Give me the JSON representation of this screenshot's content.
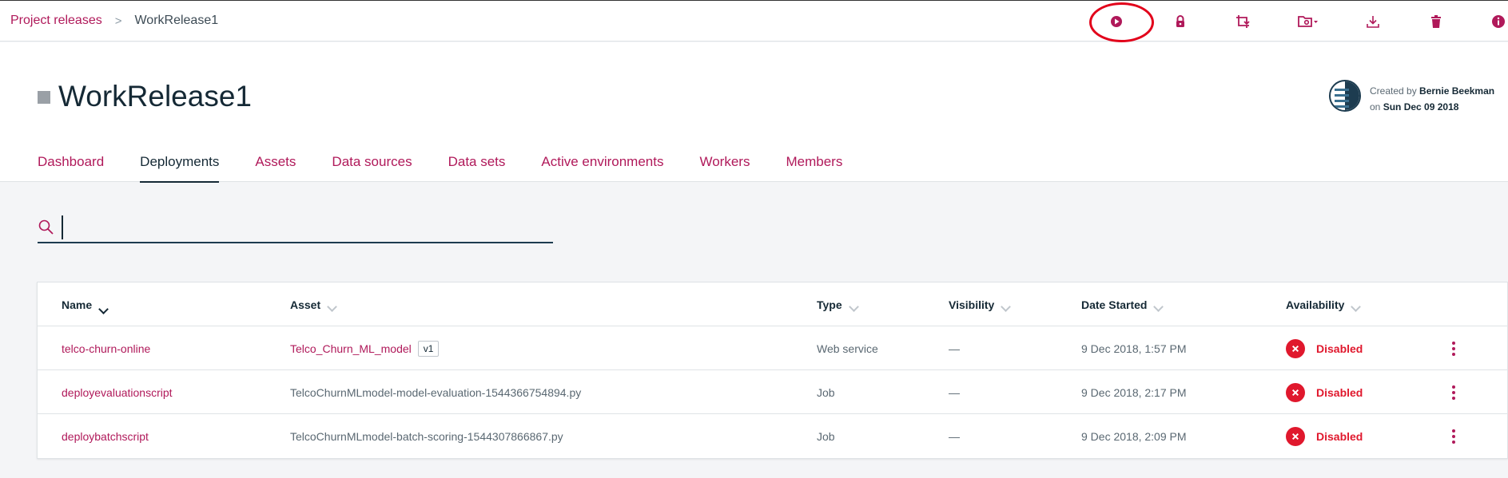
{
  "breadcrumb": {
    "parent": "Project releases",
    "separator": ">",
    "current": "WorkRelease1"
  },
  "toolbar": {
    "icons": [
      "play-icon",
      "lock-icon",
      "new-version-icon",
      "folder-menu-icon",
      "download-icon",
      "trash-icon",
      "info-icon"
    ],
    "accent": "#b0195a",
    "annotation_ring_color": "#e2001a"
  },
  "project": {
    "title": "WorkRelease1"
  },
  "creator": {
    "created_by_label": "Created by",
    "name": "Bernie Beekman",
    "on_label": "on",
    "date": "Sun Dec 09 2018"
  },
  "tabs": [
    {
      "label": "Dashboard"
    },
    {
      "label": "Deployments",
      "active": true
    },
    {
      "label": "Assets"
    },
    {
      "label": "Data sources"
    },
    {
      "label": "Data sets"
    },
    {
      "label": "Active environments"
    },
    {
      "label": "Workers"
    },
    {
      "label": "Members"
    }
  ],
  "search": {
    "value": "",
    "placeholder": ""
  },
  "table": {
    "columns": [
      "Name",
      "Asset",
      "Type",
      "Visibility",
      "Date Started",
      "Availability"
    ],
    "rows": [
      {
        "name": "telco-churn-online",
        "asset": "Telco_Churn_ML_model",
        "version": "v1",
        "type": "Web service",
        "visibility": "—",
        "date": "9 Dec 2018, 1:57 PM",
        "availability": "Disabled"
      },
      {
        "name": "deployevaluationscript",
        "asset": "TelcoChurnMLmodel-model-evaluation-1544366754894.py",
        "version": "",
        "type": "Job",
        "visibility": "—",
        "date": "9 Dec 2018, 2:17 PM",
        "availability": "Disabled"
      },
      {
        "name": "deploybatchscript",
        "asset": "TelcoChurnMLmodel-batch-scoring-1544307866867.py",
        "version": "",
        "type": "Job",
        "visibility": "—",
        "date": "9 Dec 2018, 2:09 PM",
        "availability": "Disabled"
      }
    ]
  },
  "colors": {
    "link": "#b0195a",
    "error": "#e0182d",
    "text": "#152935"
  }
}
